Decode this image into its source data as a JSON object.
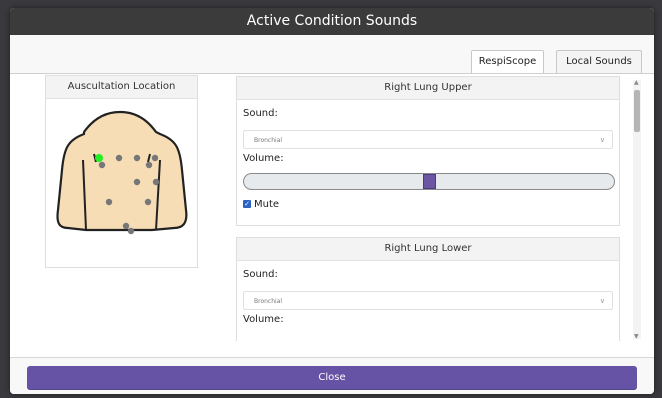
{
  "dialog": {
    "title": "Active Condition Sounds"
  },
  "tabs": {
    "respiscope": "RespiScope",
    "local_sounds": "Local Sounds"
  },
  "location_panel": {
    "title": "Auscultation Location"
  },
  "cards": [
    {
      "title": "Right Lung Upper",
      "sound_label": "Sound:",
      "sound_value": "Bronchial",
      "volume_label": "Volume:",
      "volume_level": 0.5,
      "mute_label": "Mute",
      "mute_checked": true
    },
    {
      "title": "Right Lung Lower",
      "sound_label": "Sound:",
      "sound_value": "Bronchial",
      "volume_label": "Volume:"
    }
  ],
  "footer": {
    "close_label": "Close"
  },
  "colors": {
    "accent": "#6653a5",
    "titlebar": "#3b3b3b",
    "active_point": "#22ee22",
    "inactive_point": "#777777",
    "skin": "#f6ddb5"
  },
  "icons": {
    "dropdown": "chevron-down-icon",
    "scroll_up": "triangle-up-icon",
    "scroll_down": "triangle-down-icon"
  }
}
